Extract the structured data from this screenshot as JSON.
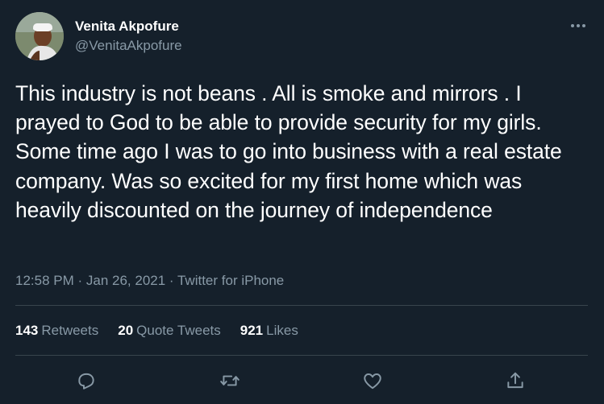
{
  "author": {
    "display_name": "Venita Akpofure",
    "handle": "@VenitaAkpofure",
    "avatar_icon": "profile-photo"
  },
  "tweet": {
    "text": "This industry is not beans . All is smoke and mirrors . I prayed to God to be able to provide security for my girls. Some time ago I was to go into business with a real estate company. Was so excited for my first home which was heavily discounted on the journey of independence",
    "meta": "12:58 PM · Jan 26, 2021 · Twitter for iPhone"
  },
  "stats": {
    "retweets_count": "143",
    "retweets_label": "Retweets",
    "quotes_count": "20",
    "quotes_label": "Quote Tweets",
    "likes_count": "921",
    "likes_label": "Likes"
  },
  "actions": {
    "reply_icon": "reply-icon",
    "retweet_icon": "retweet-icon",
    "like_icon": "heart-icon",
    "share_icon": "share-icon"
  },
  "colors": {
    "background": "#15202b",
    "text_primary": "#ffffff",
    "text_secondary": "#8899a6",
    "divider": "#38444d"
  }
}
